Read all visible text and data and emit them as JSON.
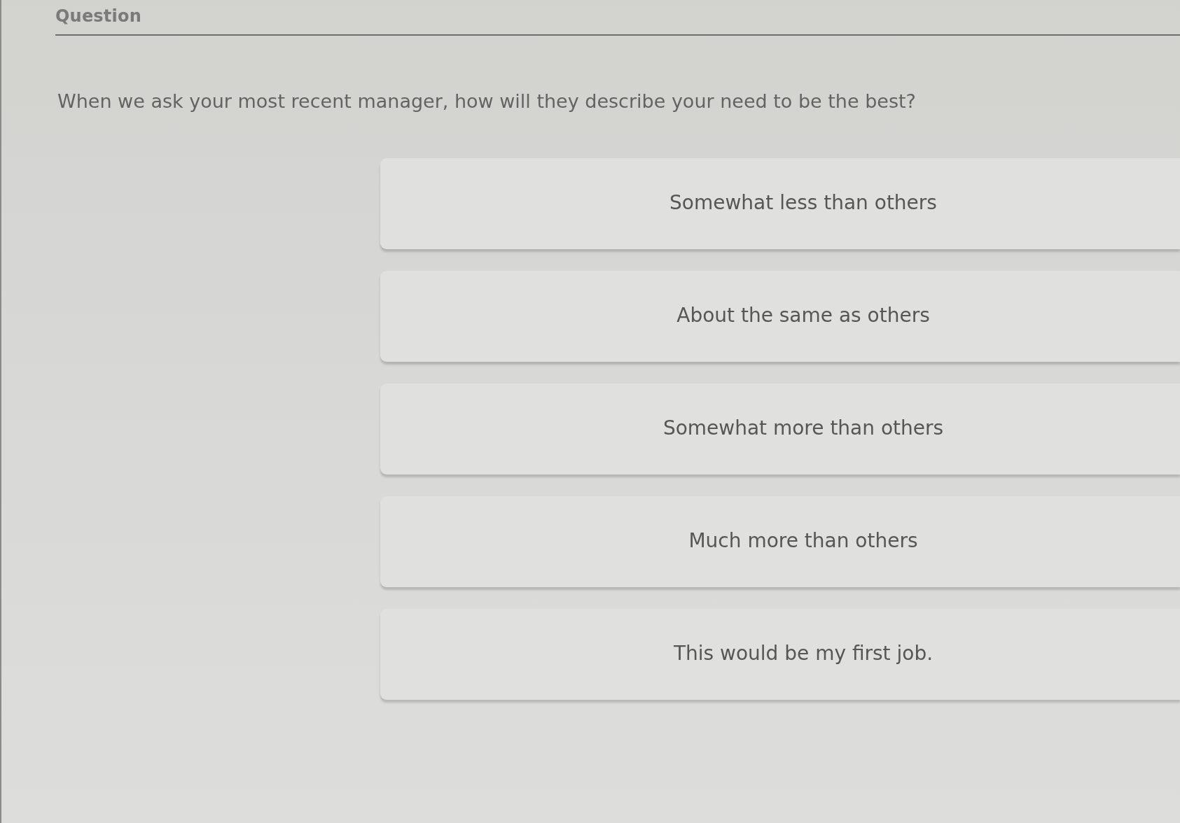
{
  "header": {
    "title": "Question"
  },
  "question": {
    "text": "When we ask your most recent manager, how will they describe your need to be the best?"
  },
  "options": [
    {
      "label": "Somewhat less than others",
      "selected": false
    },
    {
      "label": "About the same as others",
      "selected": false
    },
    {
      "label": "Somewhat more than others",
      "selected": false
    },
    {
      "label": "Much more than others",
      "selected": false
    },
    {
      "label": "This would be my first job.",
      "selected": false
    }
  ]
}
